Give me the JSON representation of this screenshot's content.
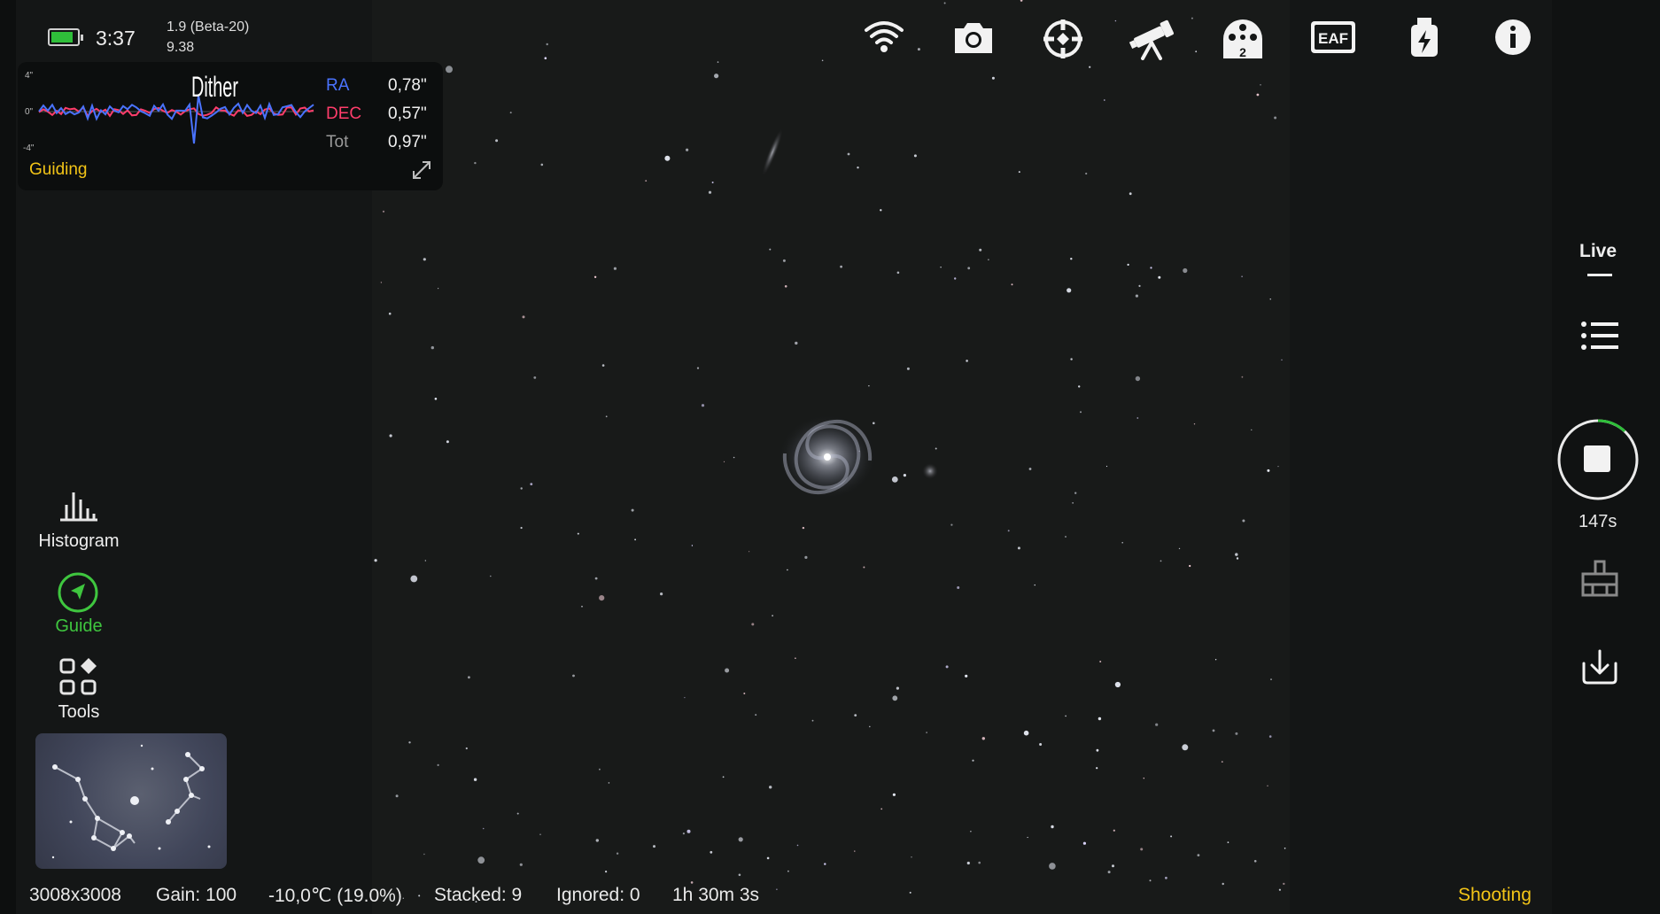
{
  "status": {
    "time": "3:37",
    "version_line1": "1.9 (Beta-20)",
    "version_line2": "9.38",
    "battery_level": 0.85,
    "battery_color": "#2fbf3a"
  },
  "guide_panel": {
    "event_label": "Dither",
    "axis_top": "4\"",
    "axis_mid": "0\"",
    "axis_bottom": "-4\"",
    "ra_label": "RA",
    "ra_value": "0,78\"",
    "dec_label": "DEC",
    "dec_value": "0,57\"",
    "tot_label": "Tot",
    "tot_value": "0,97\"",
    "status_label": "Guiding",
    "ra_color": "#4a73ff",
    "dec_color": "#ff3d6b",
    "accent_color": "#f2c417"
  },
  "left_tools": [
    {
      "label": "Histogram",
      "icon": "histogram-icon",
      "active": false
    },
    {
      "label": "Guide",
      "icon": "guide-compass-icon",
      "active": true
    },
    {
      "label": "Tools",
      "icon": "tools-grid-icon",
      "active": false
    }
  ],
  "top_icons": [
    "wifi-icon",
    "camera-icon",
    "target-crosshair-icon",
    "telescope-icon",
    "filter-wheel-icon",
    "eaf-focuser-icon",
    "usb-power-icon",
    "info-icon"
  ],
  "filter_wheel_position": "2",
  "eaf_label": "EAF",
  "right_bar": {
    "mode_label": "Live",
    "exposure_timer": "147s",
    "progress_fraction": 0.12,
    "ring_color": "#2fbf3a"
  },
  "bottom_bar": {
    "resolution": "3008x3008",
    "gain": "Gain: 100",
    "temperature": "-10,0℃  (19.0%)",
    "stacked": "Stacked: 9",
    "ignored": "Ignored: 0",
    "elapsed": "1h 30m 3s",
    "state": "Shooting"
  }
}
